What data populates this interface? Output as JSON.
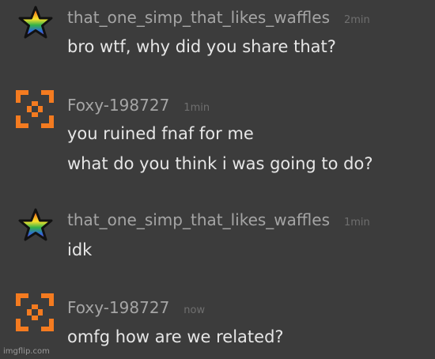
{
  "messages": [
    {
      "username": "that_one_simp_that_likes_waffles",
      "time": "2min",
      "avatar_icon": "rainbow-star-icon",
      "lines": [
        "bro wtf, why did you share that?"
      ]
    },
    {
      "username": "Foxy-198727",
      "time": "1min",
      "avatar_icon": "orange-bracket-icon",
      "lines": [
        "you ruined fnaf for me",
        "what do you think i was going to do?"
      ]
    },
    {
      "username": "that_one_simp_that_likes_waffles",
      "time": "1min",
      "avatar_icon": "rainbow-star-icon",
      "lines": [
        "idk"
      ]
    },
    {
      "username": "Foxy-198727",
      "time": "now",
      "avatar_icon": "orange-bracket-icon",
      "lines": [
        "omfg how are we related?"
      ]
    }
  ],
  "watermark": "imgflip.com",
  "colors": {
    "background": "#3c3c3c",
    "username": "#a5a5a5",
    "timestamp": "#6f6f6f",
    "text": "#e6e6e6",
    "orange_avatar": "#f47b20"
  }
}
